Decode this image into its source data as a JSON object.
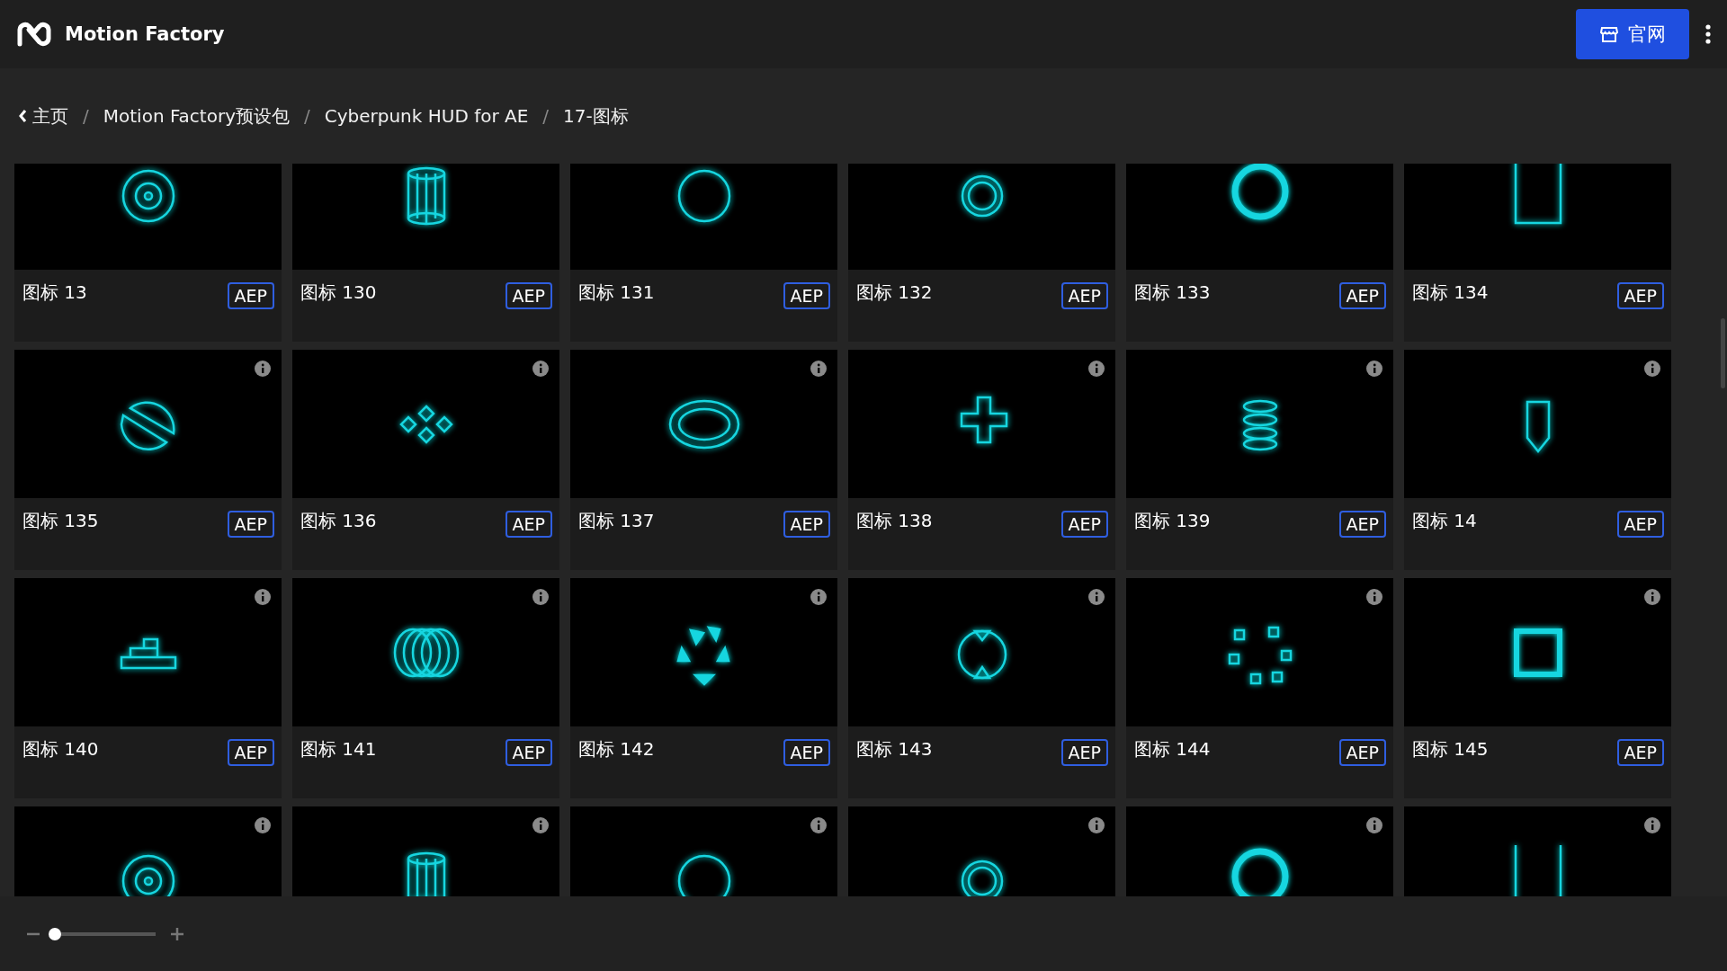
{
  "app": {
    "name": "Motion Factory"
  },
  "header": {
    "website_button": "官网"
  },
  "breadcrumb": [
    "主页",
    "Motion Factory预设包",
    "Cyberpunk HUD for AE",
    "17-图标"
  ],
  "breadcrumb_separator": "/",
  "cards": [
    {
      "title": "图标 13",
      "format": "AEP"
    },
    {
      "title": "图标 130",
      "format": "AEP"
    },
    {
      "title": "图标 131",
      "format": "AEP"
    },
    {
      "title": "图标 132",
      "format": "AEP"
    },
    {
      "title": "图标 133",
      "format": "AEP"
    },
    {
      "title": "图标 134",
      "format": "AEP"
    },
    {
      "title": "图标 135",
      "format": "AEP"
    },
    {
      "title": "图标 136",
      "format": "AEP"
    },
    {
      "title": "图标 137",
      "format": "AEP"
    },
    {
      "title": "图标 138",
      "format": "AEP"
    },
    {
      "title": "图标 139",
      "format": "AEP"
    },
    {
      "title": "图标 14",
      "format": "AEP"
    },
    {
      "title": "图标 140",
      "format": "AEP"
    },
    {
      "title": "图标 141",
      "format": "AEP"
    },
    {
      "title": "图标 142",
      "format": "AEP"
    },
    {
      "title": "图标 143",
      "format": "AEP"
    },
    {
      "title": "图标 144",
      "format": "AEP"
    },
    {
      "title": "图标 145",
      "format": "AEP"
    },
    {
      "kind": "cut_off"
    },
    {
      "kind": "cut_off"
    },
    {
      "kind": "cut_off"
    },
    {
      "kind": "cut_off"
    },
    {
      "kind": "cut_off"
    },
    {
      "kind": "cut_off"
    }
  ],
  "zoom_slider": {
    "level": 0.0
  }
}
